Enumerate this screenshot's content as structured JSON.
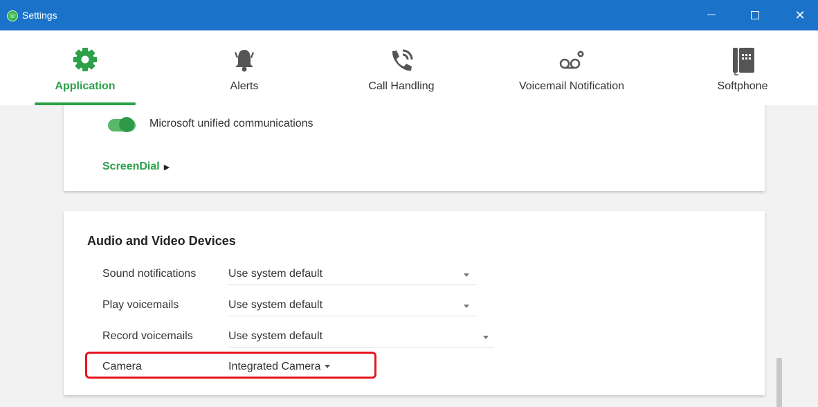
{
  "window": {
    "title": "Settings",
    "app_icon": "app-logo-icon",
    "controls": {
      "minimize_icon": "minimize-icon",
      "maximize_icon": "maximize-icon",
      "close_icon": "close-icon",
      "close_glyph": "✕"
    }
  },
  "tabs": [
    {
      "label": "Application",
      "icon": "gear-icon",
      "active": true
    },
    {
      "label": "Alerts",
      "icon": "bell-icon",
      "active": false
    },
    {
      "label": "Call Handling",
      "icon": "phone-ringing-icon",
      "active": false
    },
    {
      "label": "Voicemail Notification",
      "icon": "voicemail-icon",
      "active": false
    },
    {
      "label": "Softphone",
      "icon": "desk-phone-icon",
      "active": false
    }
  ],
  "integration_card": {
    "toggle_label": "Microsoft unified communications",
    "toggle_on": true,
    "screendial_link": "ScreenDial",
    "screendial_arrow": "▶"
  },
  "devices_card": {
    "title": "Audio and Video Devices",
    "rows": [
      {
        "label": "Sound notifications",
        "value": "Use system default"
      },
      {
        "label": "Play voicemails",
        "value": "Use system default"
      },
      {
        "label": "Record voicemails",
        "value": "Use system default"
      },
      {
        "label": "Camera",
        "value": "Integrated Camera"
      }
    ]
  },
  "colors": {
    "titlebar": "#1a73c9",
    "accent_green": "#2ca14a",
    "highlight_red": "#e5161d"
  }
}
